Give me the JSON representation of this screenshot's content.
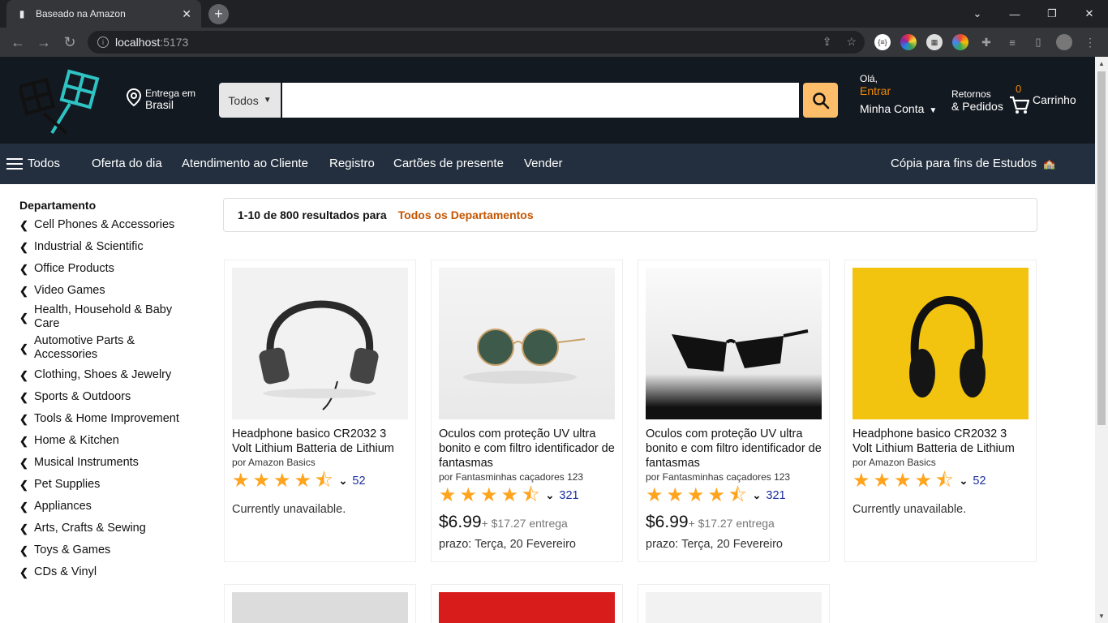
{
  "browser": {
    "tab_title": "Baseado na Amazon",
    "url_host": "localhost",
    "url_port": ":5173"
  },
  "header": {
    "deliver_line1": "Entrega em",
    "deliver_line2": "Brasil",
    "search_category": "Todos",
    "account_hello": "Olá,",
    "account_signin": "Entrar",
    "account_label": "Minha Conta",
    "returns_line1": "Retornos",
    "returns_line2": "& Pedidos",
    "cart_count": "0",
    "cart_label": "Carrinho",
    "accent_color": "#f08804"
  },
  "subnav": {
    "menu_label": "Todos",
    "items": [
      "Oferta do dia",
      "Atendimento ao Cliente",
      "Registro",
      "Cartões de presente",
      "Vender"
    ],
    "right_text": "Cópia para fins de Estudos"
  },
  "sidebar": {
    "heading": "Departamento",
    "departments": [
      "Cell Phones & Accessories",
      "Industrial & Scientific",
      "Office Products",
      "Video Games",
      "Health, Household & Baby Care",
      "Automotive Parts & Accessories",
      "Clothing, Shoes & Jewelry",
      "Sports & Outdoors",
      "Tools & Home Improvement",
      "Home & Kitchen",
      "Musical Instruments",
      "Pet Supplies",
      "Appliances",
      "Arts, Crafts & Sewing",
      "Toys & Games",
      "CDs & Vinyl"
    ]
  },
  "results": {
    "summary": "1-10 de 800 resultados para",
    "department": "Todos os Departamentos"
  },
  "products": [
    {
      "title": "Headphone basico CR2032 3 Volt Lithium Batteria de Lithium",
      "by": "por Amazon Basics",
      "rating": 4.5,
      "reviews": "52",
      "availability": "Currently unavailable.",
      "price": "",
      "shipping": "",
      "delivery": ""
    },
    {
      "title": "Oculos com proteção UV ultra bonito e com filtro identificador de fantasmas",
      "by": "por Fantasminhas caçadores 123",
      "rating": 4.5,
      "reviews": "321",
      "availability": "",
      "price": "$6.99",
      "shipping": "+ $17.27 entrega",
      "delivery": "prazo: Terça, 20 Fevereiro"
    },
    {
      "title": "Oculos com proteção UV ultra bonito e com filtro identificador de fantasmas",
      "by": "por Fantasminhas caçadores 123",
      "rating": 4.5,
      "reviews": "321",
      "availability": "",
      "price": "$6.99",
      "shipping": "+ $17.27 entrega",
      "delivery": "prazo: Terça, 20 Fevereiro"
    },
    {
      "title": "Headphone basico CR2032 3 Volt Lithium Batteria de Lithium",
      "by": "por Amazon Basics",
      "rating": 4.5,
      "reviews": "52",
      "availability": "Currently unavailable.",
      "price": "",
      "shipping": "",
      "delivery": ""
    }
  ]
}
